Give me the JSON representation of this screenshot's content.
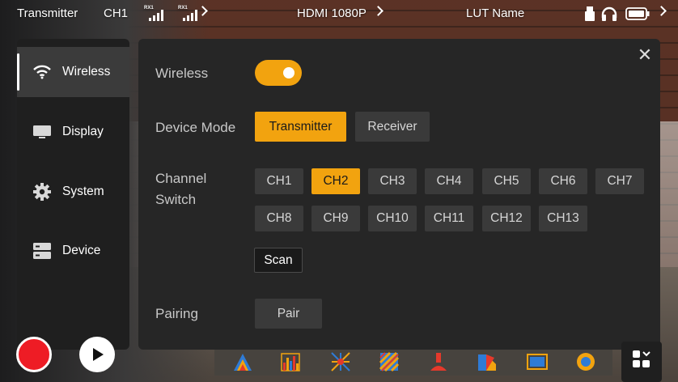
{
  "status_bar": {
    "mode": "Transmitter",
    "channel": "CH1",
    "rx1_label": "RX1",
    "rx2_label": "RX1",
    "video_format": "HDMI 1080P",
    "lut": "LUT Name"
  },
  "sidebar": {
    "items": [
      {
        "label": "Wireless",
        "icon": "wifi-icon",
        "active": true
      },
      {
        "label": "Display",
        "icon": "monitor-icon",
        "active": false
      },
      {
        "label": "System",
        "icon": "gear-icon",
        "active": false
      },
      {
        "label": "Device",
        "icon": "server-icon",
        "active": false
      }
    ]
  },
  "panel": {
    "wireless_label": "Wireless",
    "wireless_on": true,
    "device_mode_label": "Device Mode",
    "modes": [
      "Transmitter",
      "Receiver"
    ],
    "selected_mode": "Transmitter",
    "channel_label_line1": "Channel",
    "channel_label_line2": "Switch",
    "channels": [
      "CH1",
      "CH2",
      "CH3",
      "CH4",
      "CH5",
      "CH6",
      "CH7",
      "CH8",
      "CH9",
      "CH10",
      "CH11",
      "CH12",
      "CH13"
    ],
    "selected_channel": "CH2",
    "scan_label": "Scan",
    "pairing_label": "Pairing",
    "pair_label": "Pair"
  },
  "colors": {
    "accent": "#f2a30f",
    "record": "#ee1c25"
  },
  "toolbar_icons": [
    "waveform-icon",
    "histogram-icon",
    "vectorscope-icon",
    "zebra-icon",
    "false-color-icon",
    "color-bars-icon",
    "frame-guide-icon",
    "focus-assist-icon"
  ]
}
